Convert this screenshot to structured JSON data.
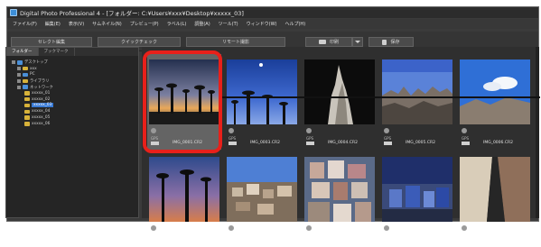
{
  "window": {
    "title": "Digital Photo Professional 4 - [フォルダー: C:¥Users¥xxx¥Desktop¥xxxxx_03]"
  },
  "menu": [
    "ファイル(F)",
    "編集(E)",
    "表示(V)",
    "サムネイル(N)",
    "プレビュー(P)",
    "ラベル(L)",
    "調整(A)",
    "ツール(T)",
    "ウィンドウ(W)",
    "ヘルプ(H)"
  ],
  "toolbar": {
    "select_edit": "セレクト編集",
    "quick_check": "クイックチェック",
    "remote_capture": "リモート撮影",
    "print": "印刷",
    "save": "保存"
  },
  "sidebar": {
    "tabs": [
      "フォルダー",
      "ブックマーク"
    ],
    "tree": [
      {
        "label": "デスクトップ",
        "type": "blue"
      },
      {
        "label": "xxx",
        "type": "folder"
      },
      {
        "label": "PC",
        "type": "blue"
      },
      {
        "label": "ライブラリ",
        "type": "folder"
      },
      {
        "label": "ネットワーク",
        "type": "blue"
      },
      {
        "label": "xxxxx_01",
        "type": "folder"
      },
      {
        "label": "xxxxx_02",
        "type": "folder"
      },
      {
        "label": "xxxxx_03",
        "type": "folder",
        "selected": true
      },
      {
        "label": "xxxxx_04",
        "type": "folder"
      },
      {
        "label": "xxxxx_05",
        "type": "folder"
      },
      {
        "label": "xxxxx_06",
        "type": "folder"
      }
    ]
  },
  "thumbnails": [
    {
      "filename": "IMG_0001.CR2",
      "gps": "GPS",
      "selected": true,
      "scene": "baobab-sunset"
    },
    {
      "filename": "IMG_0003.CR2",
      "gps": "GPS",
      "scene": "baobab-night"
    },
    {
      "filename": "IMG_0004.CR2",
      "gps": "GPS",
      "scene": "rock-spire"
    },
    {
      "filename": "IMG_0005.CR2",
      "gps": "GPS",
      "scene": "rock-formation"
    },
    {
      "filename": "IMG_0006.CR2",
      "gps": "GPS",
      "scene": "blue-sky"
    },
    {
      "filename": "",
      "gps": "",
      "scene": "baobab-dusk"
    },
    {
      "filename": "",
      "gps": "",
      "scene": "village"
    },
    {
      "filename": "",
      "gps": "",
      "scene": "city"
    },
    {
      "filename": "",
      "gps": "",
      "scene": "town-blue"
    },
    {
      "filename": "",
      "gps": "",
      "scene": "street"
    }
  ],
  "colors": {
    "highlight": "#e8201a",
    "selection": "#3a7bd5"
  }
}
